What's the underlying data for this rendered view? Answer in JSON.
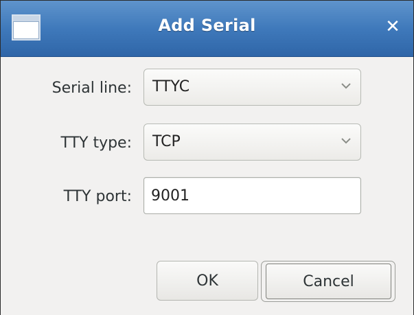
{
  "window": {
    "title": "Add Serial",
    "close_label": "✕",
    "titlebar_color": "#3f79bb",
    "window_icon": "window-icon"
  },
  "form": {
    "serial_line": {
      "label": "Serial line:",
      "value": "TTYC"
    },
    "tty_type": {
      "label": "TTY type:",
      "value": "TCP"
    },
    "tty_port": {
      "label": "TTY port:",
      "value": "9001"
    }
  },
  "buttons": {
    "ok_label": "OK",
    "cancel_label": "Cancel"
  }
}
